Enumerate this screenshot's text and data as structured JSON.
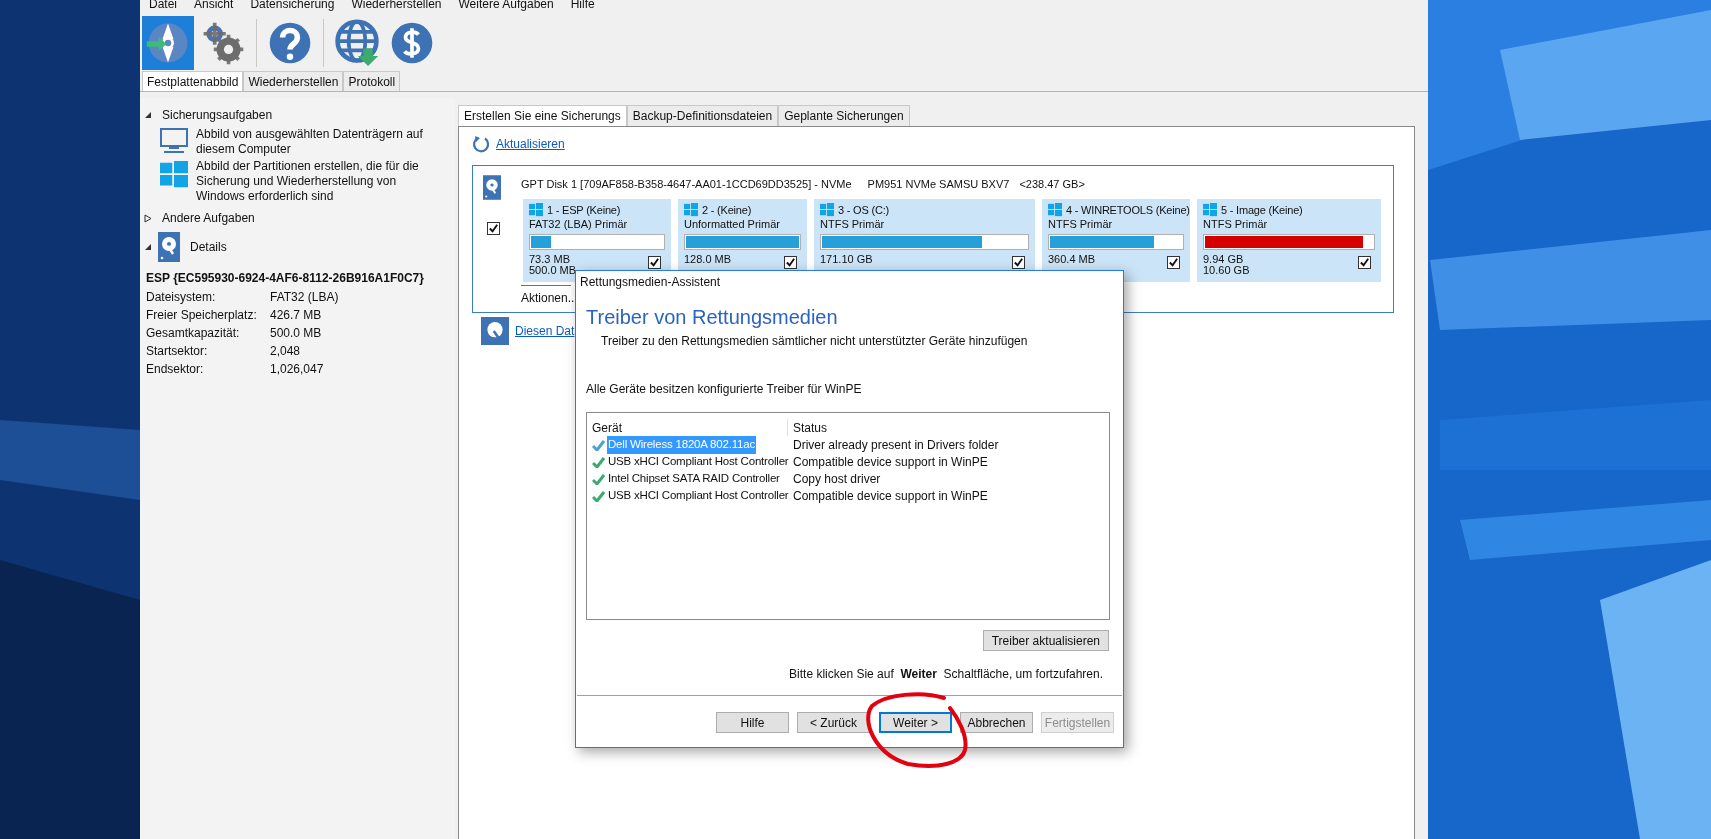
{
  "menu": [
    "Datei",
    "Ansicht",
    "Datensicherung",
    "Wiederherstellen",
    "Weitere Aufgaben",
    "Hilfe"
  ],
  "toolbar": [
    {
      "kind": "disc",
      "selected": true
    },
    {
      "kind": "gears",
      "selected": false
    },
    {
      "kind": "help",
      "selected": false
    },
    {
      "kind": "globe",
      "selected": false
    },
    {
      "kind": "dollar",
      "selected": false
    }
  ],
  "main_tabs": [
    {
      "label": "Festplattenabbild",
      "selected": true
    },
    {
      "label": "Wiederherstellen",
      "selected": false
    },
    {
      "label": "Protokoll",
      "selected": false
    }
  ],
  "sidebar": {
    "sections": [
      {
        "title": "Sicherungsaufgaben",
        "expanded": true,
        "items": [
          {
            "kind": "monitor",
            "text": "Abbild von ausgewählten Datenträgern auf diesem Computer"
          },
          {
            "kind": "windows",
            "text": "Abbild der Partitionen erstellen, die für die Sicherung und Wiederherstellung von Windows erforderlich sind"
          }
        ]
      },
      {
        "title": "Andere Aufgaben",
        "expanded": false
      },
      {
        "title": "Details",
        "expanded": true,
        "kind": "disk"
      }
    ],
    "details": {
      "title": "ESP {EC595930-6924-4AF6-8112-26B916A1F0C7}",
      "rows": [
        {
          "label": "Dateisystem:",
          "value": "FAT32 (LBA)"
        },
        {
          "label": "Freier Speicherplatz:",
          "value": "426.7 MB"
        },
        {
          "label": "Gesamtkapazität:",
          "value": "500.0 MB"
        },
        {
          "label": "Startsektor:",
          "value": "2,048"
        },
        {
          "label": "Endsektor:",
          "value": "1,026,047"
        }
      ]
    }
  },
  "content_tabs": [
    {
      "label": "Erstellen Sie eine Sicherungs",
      "selected": true
    },
    {
      "label": "Backup-Definitionsdateien",
      "selected": false
    },
    {
      "label": "Geplante Sicherungen",
      "selected": false
    }
  ],
  "refresh_link": "Aktualisieren",
  "disk": {
    "header": "GPT Disk 1 [709AF858-B358-4647-AA01-1CCD69DD3525] - NVMe",
    "model": "PM951 NVMe SAMSU BXV7",
    "size": "<238.47 GB>",
    "checked": true,
    "actions": "Aktionen..",
    "partitions": [
      {
        "name": "1 - ESP (Keine)",
        "type": "FAT32 (LBA) Primär",
        "level": 0.15,
        "color": "#26a0da",
        "used": "73.3 MB",
        "total": "500.0 MB",
        "checked": true
      },
      {
        "name": "2 -  (Keine)",
        "type": "Unformatted Primär",
        "level": 1,
        "color": "#26a0da",
        "used": "128.0 MB",
        "checked": true
      },
      {
        "name": "3 - OS (C:)",
        "type": "NTFS Primär",
        "level": 0.78,
        "color": "#26a0da",
        "used": "171.10 GB",
        "checked": true
      },
      {
        "name": "4 - WINRETOOLS (Keine)",
        "type": "NTFS Primär",
        "level": 0.79,
        "color": "#26a0da",
        "used": "360.4 MB",
        "checked": true
      },
      {
        "name": "5 - Image (Keine)",
        "type": "NTFS Primär",
        "level": 0.94,
        "color": "#d40000",
        "used": "9.94 GB",
        "total": "10.60 GB",
        "checked": true
      }
    ]
  },
  "second_link": "Diesen Dat",
  "dialog": {
    "title": "Rettungsmedien-Assistent",
    "heading": "Treiber von Rettungsmedien",
    "subtitle": "Treiber zu den Rettungsmedien sämtlicher nicht unterstützter Geräte hinzufügen",
    "message": "Alle Geräte besitzen konfigurierte Treiber für WinPE",
    "columns": [
      "Gerät",
      "Status"
    ],
    "rows": [
      {
        "device": "Dell Wireless 1820A 802.11ac",
        "status": "Driver already present in Drivers folder",
        "selected": true
      },
      {
        "device": "USB xHCI Compliant Host Controller",
        "status": "Compatible device support in WinPE",
        "selected": false
      },
      {
        "device": "Intel Chipset SATA RAID Controller",
        "status": "Copy host driver",
        "selected": false
      },
      {
        "device": "USB xHCI Compliant Host Controller",
        "status": "Compatible device support in WinPE",
        "selected": false
      }
    ],
    "update_button": "Treiber aktualisieren",
    "instruction": "Bitte klicken Sie auf  **Weiter**  Schaltfläche, um fortzufahren.",
    "buttons": [
      {
        "label": "Hilfe",
        "default": false,
        "disabled": false
      },
      {
        "label": "< Zurück",
        "default": false,
        "disabled": false
      },
      {
        "label": "Weiter >",
        "default": true,
        "disabled": false
      },
      {
        "label": "Abbrechen",
        "default": false,
        "disabled": false
      },
      {
        "label": "Fertigstellen",
        "default": false,
        "disabled": true
      }
    ]
  }
}
